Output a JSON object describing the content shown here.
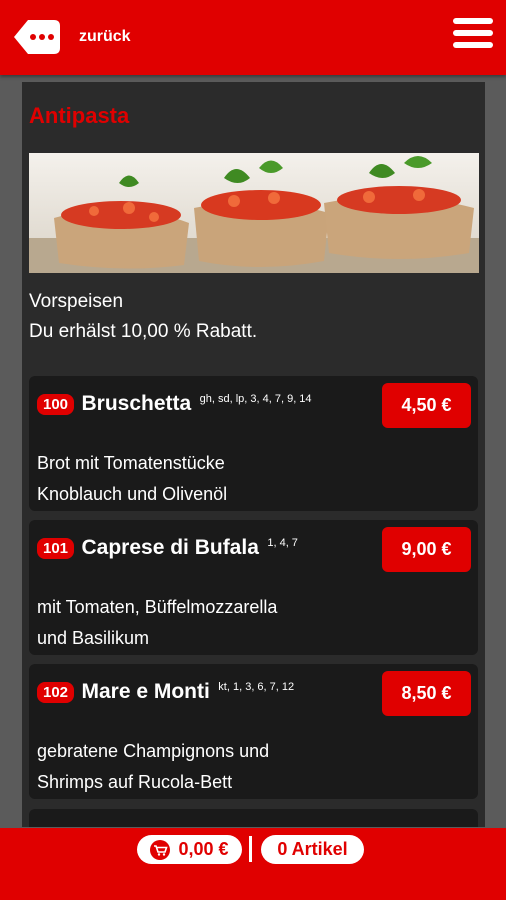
{
  "header": {
    "back_label": "zurück"
  },
  "category": {
    "title": "Antipasta",
    "intro_line1": "Vorspeisen",
    "intro_line2": "Du erhälst 10,00 % Rabatt."
  },
  "items": [
    {
      "number": "100",
      "name": "Bruschetta",
      "additives": "gh, sd, lp, 3, 4, 7, 9, 14",
      "price": "4,50 €",
      "desc_line1": "Brot mit Tomatenstücke",
      "desc_line2": "Knoblauch und Olivenöl"
    },
    {
      "number": "101",
      "name": "Caprese di Bufala",
      "additives": "1, 4, 7",
      "price": "9,00 €",
      "desc_line1": "mit Tomaten, Büffelmozzarella",
      "desc_line2": "und Basilikum"
    },
    {
      "number": "102",
      "name": "Mare e Monti",
      "additives": "kt, 1, 3, 6, 7, 12",
      "price": "8,50 €",
      "desc_line1": "gebratene Champignons und",
      "desc_line2": "Shrimps auf Rucola-Bett"
    }
  ],
  "footer": {
    "cart_total": "0,00 €",
    "articles": "0 Artikel"
  },
  "colors": {
    "brand_red": "#e00000",
    "panel": "#2b2b2b",
    "card": "#1a1a1a"
  },
  "icons": {
    "back": "speech-dots-back-icon",
    "menu": "hamburger-icon",
    "cart": "cart-icon"
  }
}
